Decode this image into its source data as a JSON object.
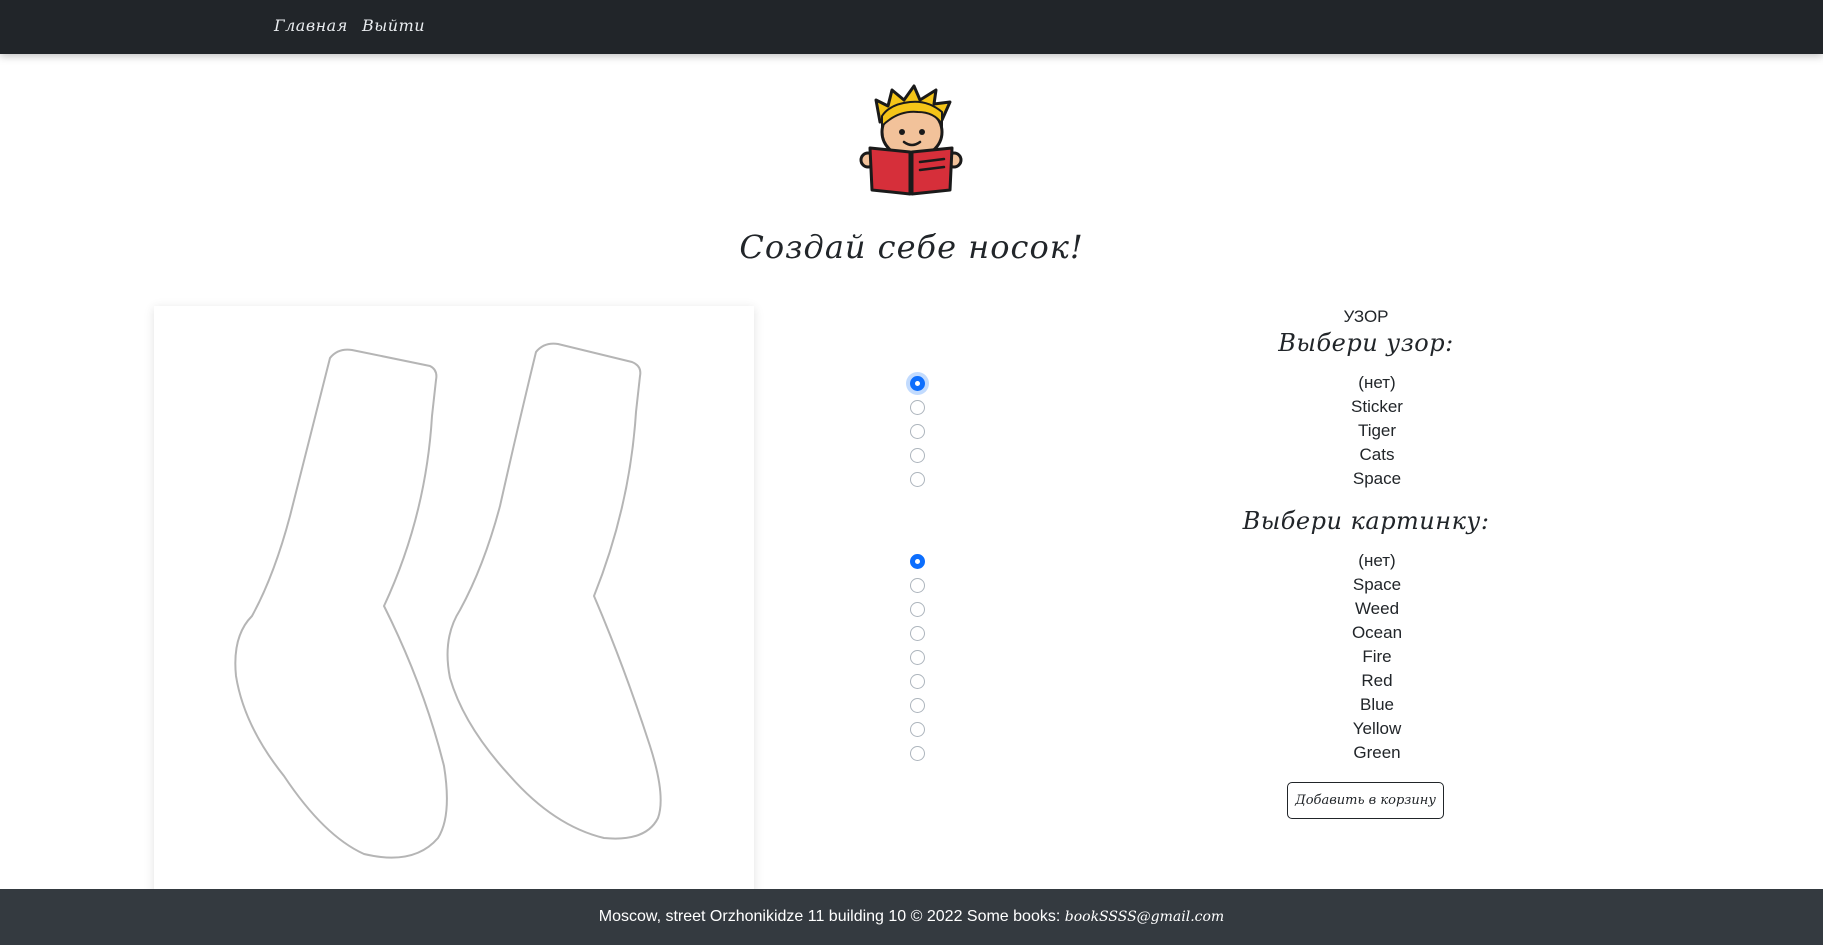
{
  "nav": {
    "home": "Главная",
    "logout": "Выйти"
  },
  "page": {
    "title": "Создай себе носок!"
  },
  "pattern": {
    "small_heading": "УЗОР",
    "heading": "Выбери узор:",
    "options": [
      "(нет)",
      "Sticker",
      "Tiger",
      "Cats",
      "Space"
    ],
    "selected": "(нет)"
  },
  "picture": {
    "heading": "Выбери картинку:",
    "options": [
      "(нет)",
      "Space",
      "Weed",
      "Ocean",
      "Fire",
      "Red",
      "Blue",
      "Yellow",
      "Green"
    ],
    "selected": "(нет)"
  },
  "cart_button": "Добавить в корзину",
  "footer": {
    "text": "Moscow, street Orzhonikidze 11 building 10 © 2022 Some books:",
    "email": "bookSSSS@gmail.com"
  },
  "colors": {
    "navbar": "#212529",
    "footer": "#343a40",
    "accent": "#0d6efd",
    "book": "#d62f3a",
    "hair": "#f5c518"
  },
  "icons": {
    "logo": "boy-reading-book-icon"
  }
}
